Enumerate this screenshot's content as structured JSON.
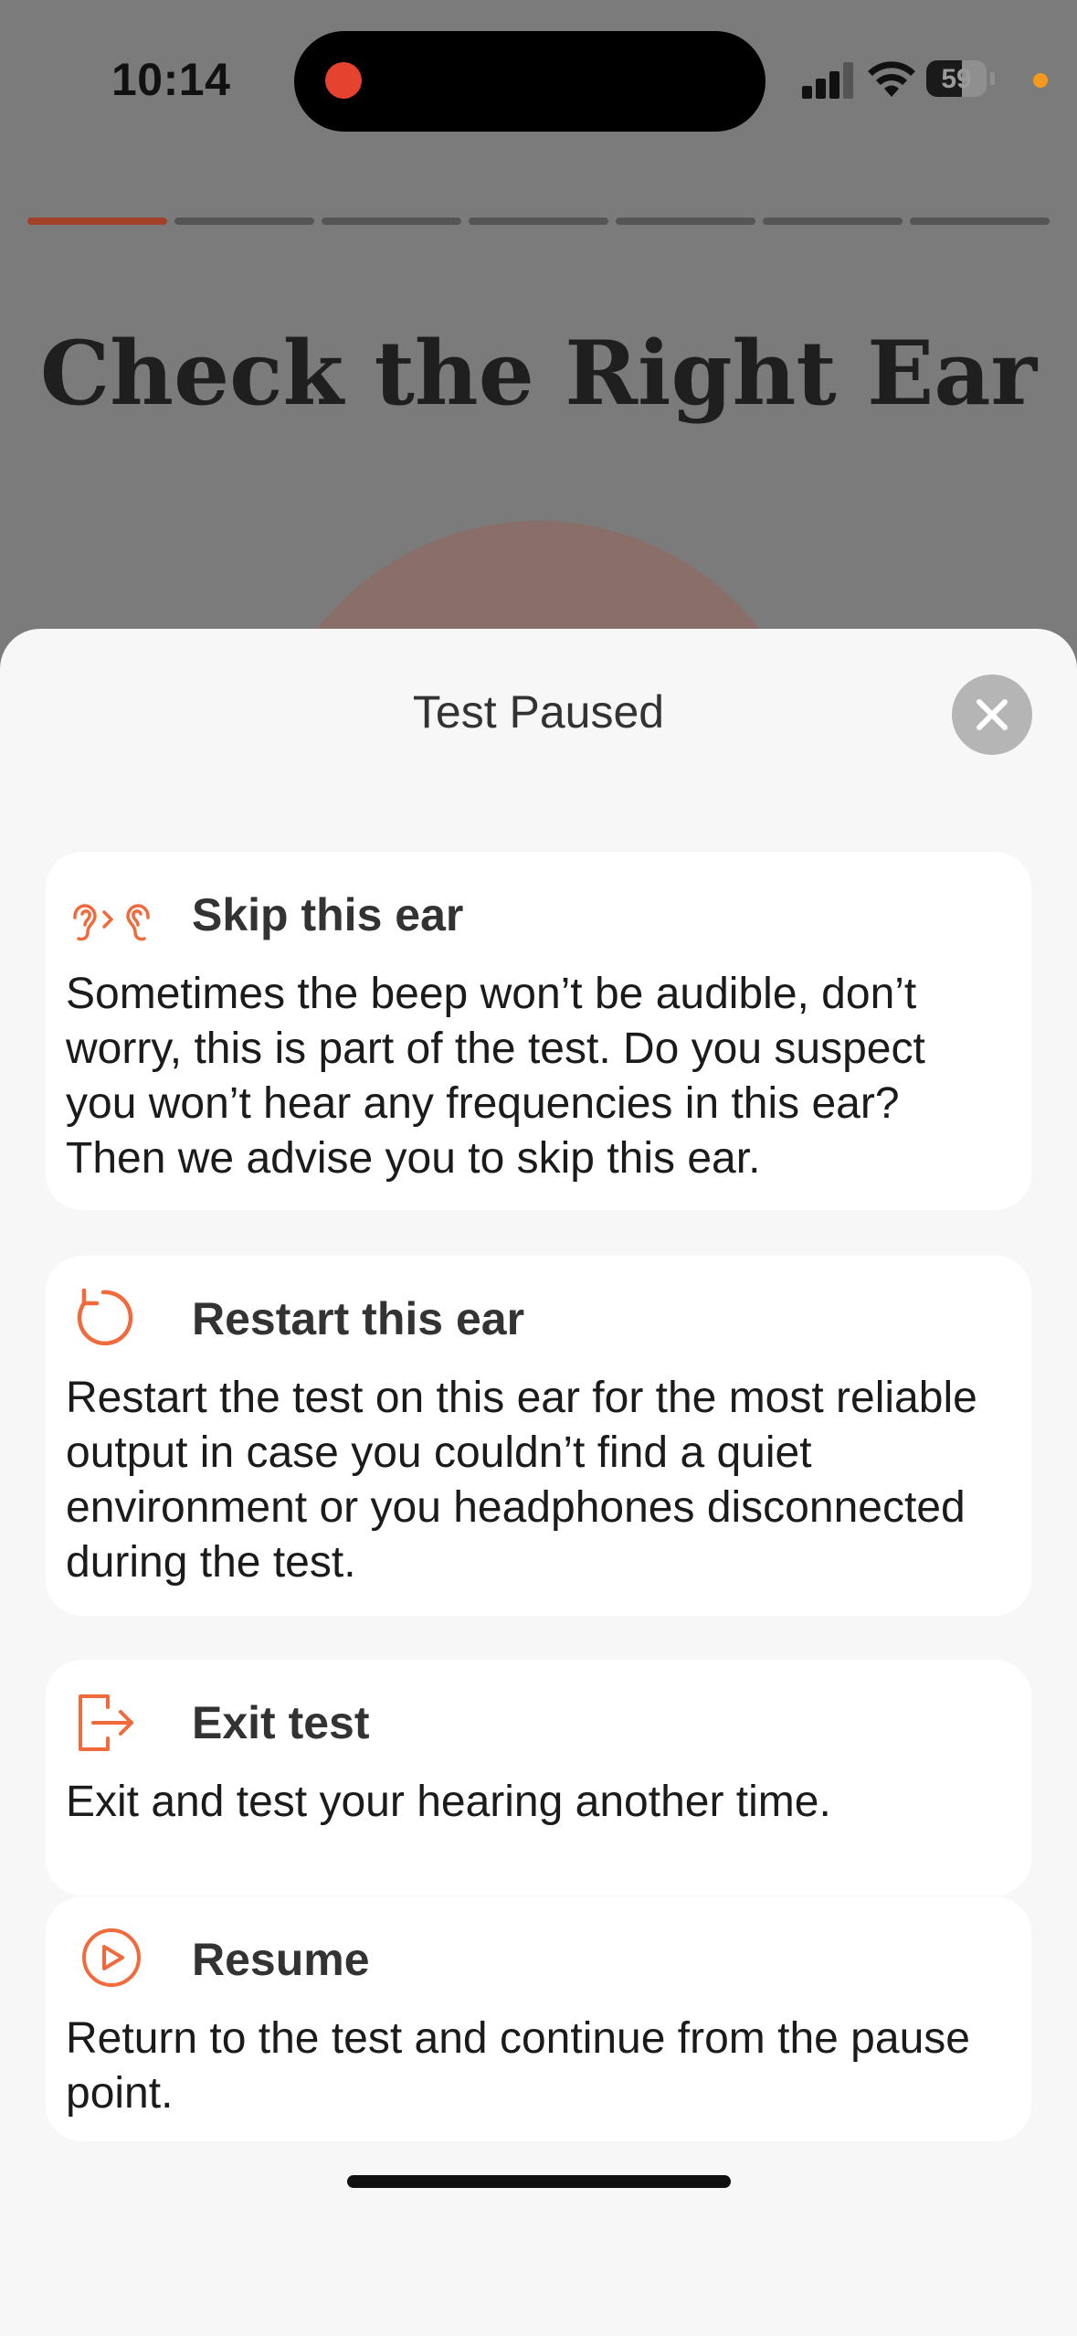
{
  "status_bar": {
    "time": "10:14",
    "battery": "59",
    "battery_level": 0.59
  },
  "progress": {
    "total_steps": 7,
    "current_step": 1
  },
  "background": {
    "title": "Check the Right Ear"
  },
  "sheet": {
    "title": "Test Paused",
    "close_icon": "close-x-icon",
    "options": [
      {
        "icon": "ear-switch-icon",
        "title": "Skip this ear",
        "description": "Sometimes the beep won’t be audible, don’t worry, this is part of the test. Do you suspect you won’t hear any frequencies in this ear? Then we advise you to skip this ear."
      },
      {
        "icon": "restart-icon",
        "title": "Restart this ear",
        "description": "Restart the test on this ear for the most reliable output in case you couldn’t find a quiet environment or you headphones disconnected during the test."
      },
      {
        "icon": "exit-icon",
        "title": "Exit test",
        "description": "Exit and test your hearing another time."
      },
      {
        "icon": "play-circle-icon",
        "title": "Resume",
        "description": "Return to the test and continue from the pause point."
      }
    ]
  },
  "colors": {
    "accent": "#f06a3c",
    "progress_active": "#a4402a"
  }
}
